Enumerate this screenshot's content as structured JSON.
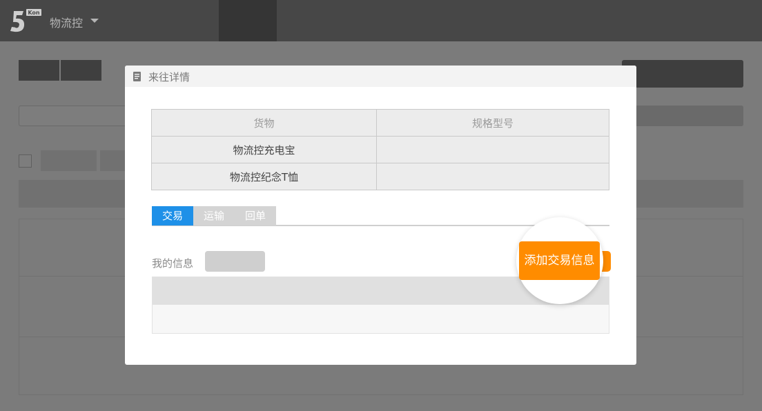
{
  "topbar": {
    "app_name": "物流控",
    "logo_text": "Kon"
  },
  "modal": {
    "title": "来往详情",
    "goods_table": {
      "headers": [
        "货物",
        "规格型号"
      ],
      "rows": [
        [
          "物流控充电宝",
          ""
        ],
        [
          "物流控纪念T恤",
          ""
        ]
      ]
    },
    "tabs": [
      {
        "label": "交易"
      },
      {
        "label": "运输"
      },
      {
        "label": "回单"
      }
    ],
    "my_info_label": "我的信息",
    "add_trade_button": "添加交易信息"
  },
  "colors": {
    "accent_blue": "#1e90e8",
    "accent_orange": "#ff8c00",
    "overlay": "#7b7b7b"
  }
}
